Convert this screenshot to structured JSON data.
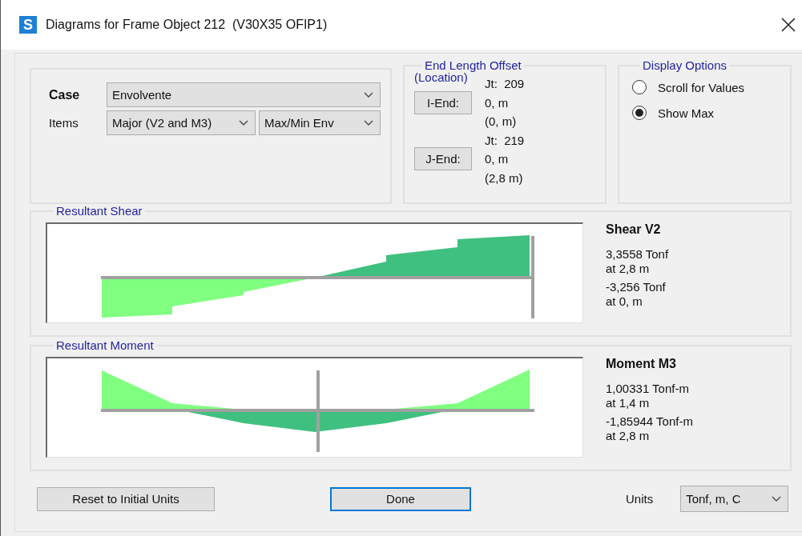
{
  "window": {
    "title": "Diagrams for Frame Object 212  (V30X35 OFIP1)",
    "app_icon": "S"
  },
  "case": {
    "label": "Case",
    "value": "Envolvente"
  },
  "items": {
    "label": "Items",
    "component": "Major (V2 and M3)",
    "type": "Max/Min Env"
  },
  "end_length_offset": {
    "title": "End Length Offset",
    "subtitle": "(Location)",
    "ends": [
      {
        "button": "I-End:",
        "joint": "Jt:  209",
        "offset": "0, m",
        "location": "(0, m)"
      },
      {
        "button": "J-End:",
        "joint": "Jt:  219",
        "offset": "0, m",
        "location": "(2,8 m)"
      }
    ]
  },
  "display_options": {
    "title": "Display Options",
    "options": [
      {
        "label": "Scroll for Values",
        "selected": false
      },
      {
        "label": "Show Max",
        "selected": true
      }
    ]
  },
  "diagrams": [
    {
      "kind": "shear",
      "title": "Resultant Shear",
      "heading": "Shear V2",
      "max_value": "3,3558 Tonf",
      "max_at": "at 2,8 m",
      "min_value": "-3,256 Tonf",
      "min_at": "at 0, m"
    },
    {
      "kind": "moment",
      "title": "Resultant Moment",
      "heading": "Moment M3",
      "max_value": "1,00331 Tonf-m",
      "max_at": "at 1,4 m",
      "min_value": "-1,85944 Tonf-m",
      "min_at": "at 2,8 m"
    }
  ],
  "buttons": {
    "reset": "Reset to Initial Units",
    "done": "Done"
  },
  "units": {
    "label": "Units",
    "value": "Tonf, m, C"
  }
}
